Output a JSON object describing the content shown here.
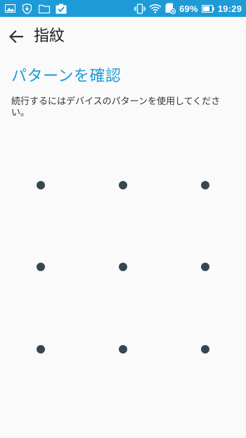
{
  "status_bar": {
    "battery_percent": "69%",
    "time": "19:29",
    "left_icons": [
      "gallery-icon",
      "download-shield-icon",
      "folder-icon",
      "clipboard-check-icon"
    ],
    "right_icons": [
      "vibrate-icon",
      "wifi-icon",
      "sdcard-icon",
      "battery-icon"
    ]
  },
  "header": {
    "title": "指紋",
    "back_icon": "back-arrow-icon"
  },
  "main": {
    "title": "パターンを確認",
    "description": "続行するにはデバイスのパターンを使用してください。"
  },
  "pattern": {
    "rows": 3,
    "cols": 3,
    "dot_color": "#37474f"
  },
  "colors": {
    "accent": "#1e9bd6",
    "background": "#fafafa",
    "text": "#222222"
  }
}
